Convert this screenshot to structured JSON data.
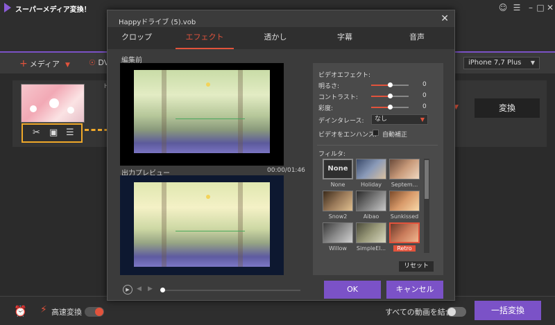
{
  "app": {
    "title": "スーパーメディア変換！",
    "window_controls": [
      "user-icon",
      "menu-icon",
      "minimize-icon",
      "maximize-icon",
      "close-icon"
    ]
  },
  "toolbar": {
    "add_media_label": "メディア",
    "dvd_label": "DV",
    "device_value": "iPhone 7,7 Plus"
  },
  "item": {
    "letter": "H",
    "convert_label": "変換"
  },
  "bottom": {
    "fast_convert_label": "高速変換",
    "merge_label": "すべての動画を結合",
    "batch_convert_label": "一括変換",
    "fast_convert_on": true,
    "merge_on": false
  },
  "dialog": {
    "title": "Happyドライブ (5).vob",
    "tabs": [
      {
        "label": "クロップ",
        "active": false
      },
      {
        "label": "エフェクト",
        "active": true
      },
      {
        "label": "透かし",
        "active": false
      },
      {
        "label": "字幕",
        "active": false
      },
      {
        "label": "音声",
        "active": false
      }
    ],
    "before_label": "編集前",
    "preview_label": "出力プレビュー",
    "time": "00:00/01:46",
    "effects": {
      "heading": "ビデオエフェクト:",
      "brightness": {
        "label": "明るさ:",
        "value": "0",
        "position": 0.5
      },
      "contrast": {
        "label": "コントラスト:",
        "value": "0",
        "position": 0.5
      },
      "saturation": {
        "label": "彩度:",
        "value": "0",
        "position": 0.5
      },
      "deinterlace_label": "デインタレース:",
      "deinterlace_value": "なし",
      "enhance_label": "ビデオをエンハンス:",
      "auto_label": "自動補正"
    },
    "filters_label": "フィルタ:",
    "filters": [
      {
        "name": "None"
      },
      {
        "name": "Holiday"
      },
      {
        "name": "Septem..."
      },
      {
        "name": "Snow2"
      },
      {
        "name": "Aibao"
      },
      {
        "name": "Sunkissed"
      },
      {
        "name": "Willow"
      },
      {
        "name": "SimpleEl..."
      },
      {
        "name": "Retro",
        "selected": true
      }
    ],
    "none_text": "None",
    "reset_label": "リセット",
    "ok_label": "OK",
    "cancel_label": "キャンセル"
  },
  "colors": {
    "accent": "#e2533c",
    "primary": "#7b52c7",
    "highlight": "#f0a92a"
  }
}
